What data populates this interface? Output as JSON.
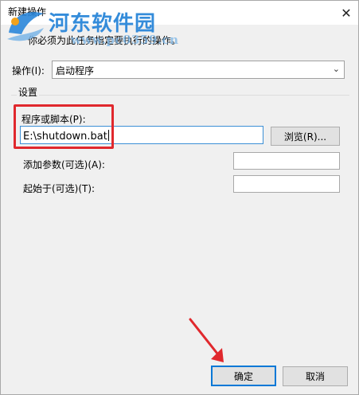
{
  "window": {
    "title": "新建操作",
    "close_glyph": "✕"
  },
  "instruction": "你必须为此任务指定要执行的操作。",
  "watermark": {
    "site_name": "河东软件园",
    "site_url": "www.pc0359.cn"
  },
  "action": {
    "label": "操作(I):",
    "selected": "启动程序"
  },
  "settings": {
    "group_label": "设置",
    "program": {
      "label": "程序或脚本(P):",
      "value": "E:\\shutdown.bat",
      "browse_label": "浏览(R)..."
    },
    "arguments": {
      "label": "添加参数(可选)(A):",
      "value": ""
    },
    "start_in": {
      "label": "起始于(可选)(T):",
      "value": ""
    }
  },
  "footer": {
    "ok_label": "确定",
    "cancel_label": "取消"
  },
  "colors": {
    "accent": "#0078d7",
    "highlight": "#e0282d",
    "watermark": "#2a86d9"
  }
}
